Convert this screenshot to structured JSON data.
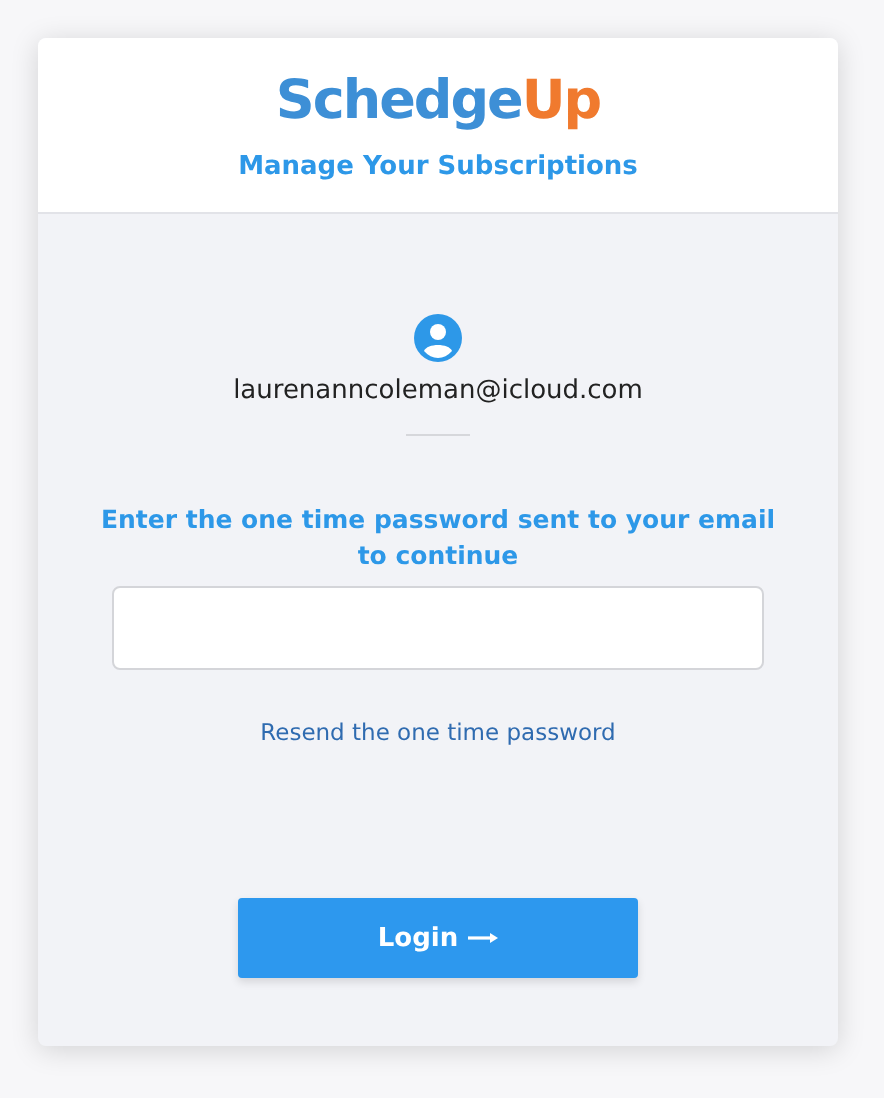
{
  "logo": {
    "parts": [
      {
        "text": "Schedge",
        "color": "#3d8fd6"
      },
      {
        "text": "Up",
        "color": "#f07a2e"
      }
    ]
  },
  "subtitle": "Manage Your Subscriptions",
  "account": {
    "email": "laurenanncoleman@icloud.com"
  },
  "prompt": "Enter the one time password sent to your email to continue",
  "resend_link": "Resend the one time password",
  "login_button": {
    "label": "Login"
  }
}
